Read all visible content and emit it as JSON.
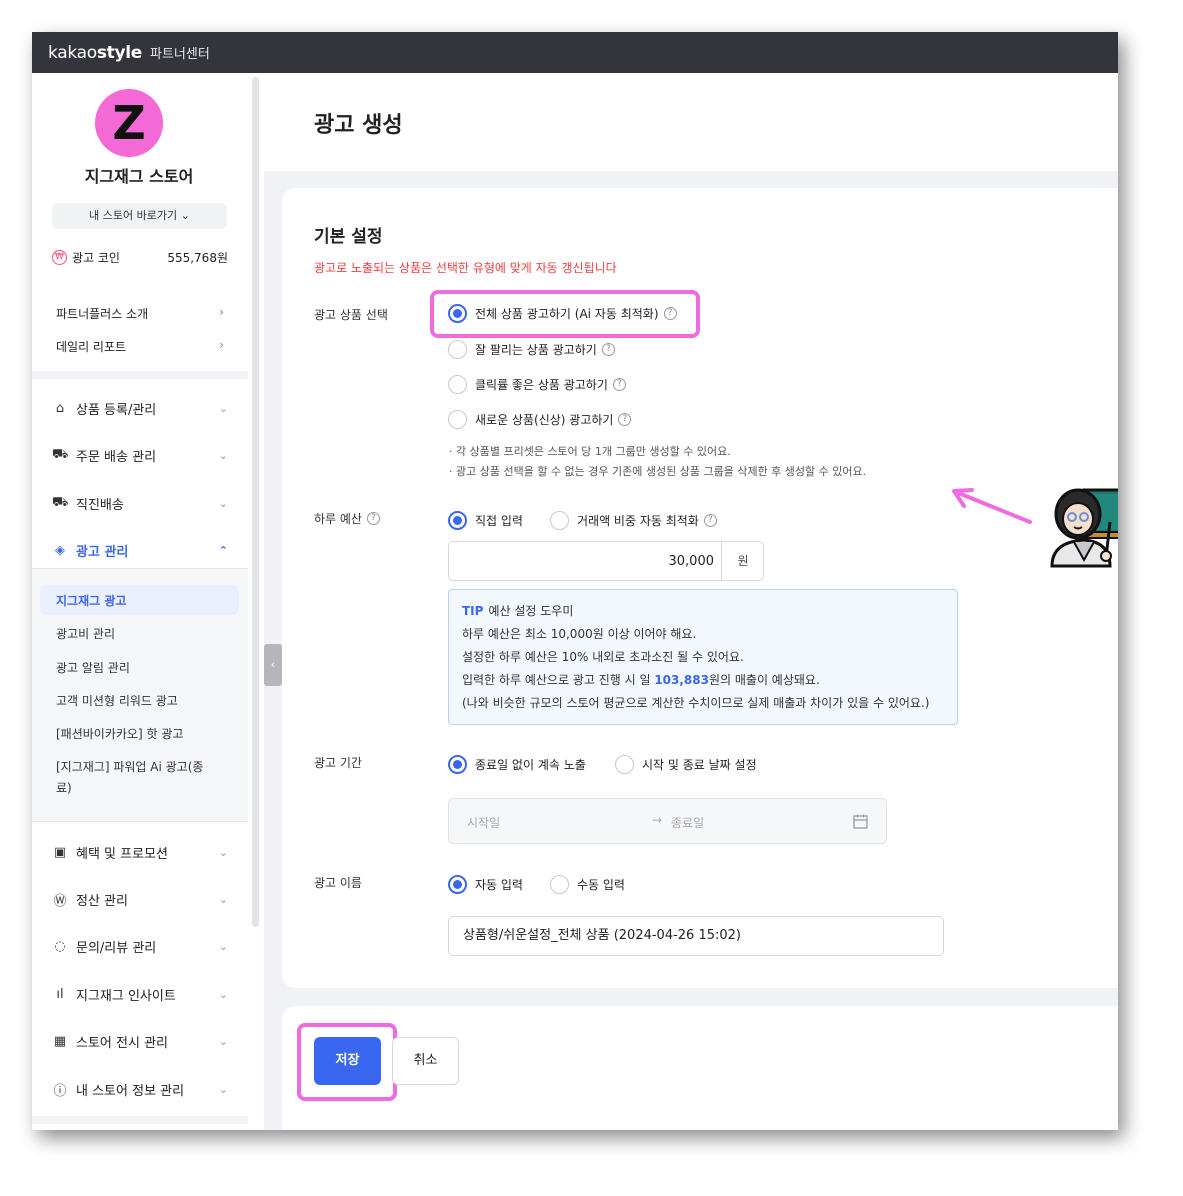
{
  "topbar": {
    "brand_light": "kakao",
    "brand_bold": "style",
    "subtitle": "파트너센터"
  },
  "sidebar": {
    "avatar_letter": "Z",
    "store_name": "지그재그 스토어",
    "store_button": "내 스토어 바로가기 ⌄",
    "coin_label": "광고 코인",
    "coin_icon": "won-icon",
    "coin_value": "555,768원",
    "quick_links": [
      {
        "label": "파트너플러스 소개",
        "arrow": "›"
      },
      {
        "label": "데일리 리포트",
        "arrow": "›"
      }
    ],
    "menu": [
      {
        "label": "상품 등록/관리",
        "icon": "hanger-icon",
        "glyph": "⌂",
        "arrow": "⌄"
      },
      {
        "label": "주문 배송 관리",
        "icon": "cart-icon",
        "glyph": "⛟",
        "arrow": "⌄"
      },
      {
        "label": "직진배송",
        "icon": "truck-icon",
        "glyph": "⛟",
        "arrow": "⌄"
      },
      {
        "label": "광고 관리",
        "icon": "megaphone-icon",
        "glyph": "◈",
        "arrow": "⌃"
      }
    ],
    "submenu": [
      "지그재그 광고",
      "광고비 관리",
      "광고 알림 관리",
      "고객 미션형 리워드 광고",
      "[패션바이카카오] 핫 광고",
      "[지그재그] 파워업 Ai 광고(종료)"
    ],
    "menu2": [
      {
        "label": "혜택 및 프로모션",
        "icon": "ticket-icon",
        "glyph": "▣",
        "arrow": "⌄"
      },
      {
        "label": "정산 관리",
        "icon": "won-circle-icon",
        "glyph": "Ⓦ",
        "arrow": "⌄"
      },
      {
        "label": "문의/리뷰 관리",
        "icon": "chat-icon",
        "glyph": "◌",
        "arrow": "⌄"
      },
      {
        "label": "지그재그 인사이트",
        "icon": "bar-chart-icon",
        "glyph": "ıl",
        "arrow": "⌄"
      },
      {
        "label": "스토어 전시 관리",
        "icon": "layout-icon",
        "glyph": "▦",
        "arrow": "⌄"
      },
      {
        "label": "내 스토어 정보 관리",
        "icon": "info-icon",
        "glyph": "ⓘ",
        "arrow": "⌄"
      }
    ],
    "collapse_glyph": "‹"
  },
  "page": {
    "title": "광고 생성",
    "section_title": "기본 설정",
    "section_note": "광고로 노출되는 상품은 선택한 유형에 맞게 자동 갱신됩니다",
    "product_select": {
      "label": "광고 상품 선택",
      "options": [
        "전체 상품 광고하기 (Ai 자동 최적화)",
        "잘 팔리는 상품 광고하기",
        "클릭률 좋은 상품 광고하기",
        "새로운 상품(신상) 광고하기"
      ],
      "selected_index": 0,
      "notes": [
        "· 각 상품별 프리셋은 스토어 당 1개 그룹만 생성할 수 있어요.",
        "· 광고 상품 선택을 할 수 없는 경우 기존에 생성된 상품 그룹을 삭제한 후 생성할 수 있어요."
      ]
    },
    "daily_budget": {
      "label": "하루 예산",
      "options": [
        "직접 입력",
        "거래액 비중 자동 최적화"
      ],
      "selected_index": 0,
      "value": "30,000",
      "unit": "원"
    },
    "tip": {
      "tag": "TIP",
      "title": "예산 설정 도우미",
      "line1": "하루 예산은 최소 10,000원 이상 이어야 해요.",
      "line2": "설정한 하루 예산은 10% 내외로 초과소진 될 수 있어요.",
      "line3_pre": "입력한 하루 예산으로 광고 진행 시 일 ",
      "line3_value": "103,883",
      "line3_post": "원의 매출이 예상돼요.",
      "line4": "(나와 비슷한 규모의 스토어 평균으로 계산한 수치이므로 실제 매출과 차이가 있을 수 있어요.)"
    },
    "period": {
      "label": "광고 기간",
      "options": [
        "종료일 없이 계속 노출",
        "시작 및 종료 날짜 설정"
      ],
      "selected_index": 0,
      "start_placeholder": "시작일",
      "arrow": "→",
      "end_placeholder": "종료일"
    },
    "ad_name": {
      "label": "광고 이름",
      "options": [
        "자동 입력",
        "수동 입력"
      ],
      "selected_index": 0,
      "value": "상품형/쉬운설정_전체 상품 (2024-04-26 15:02)"
    },
    "buttons": {
      "save": "저장",
      "cancel": "취소"
    },
    "help_glyph": "?"
  },
  "colors": {
    "accent": "#3a67f0",
    "highlight": "#ef6ce0",
    "note_red": "#f04040",
    "topbar": "#34353c",
    "avatar": "#f36ad6"
  }
}
